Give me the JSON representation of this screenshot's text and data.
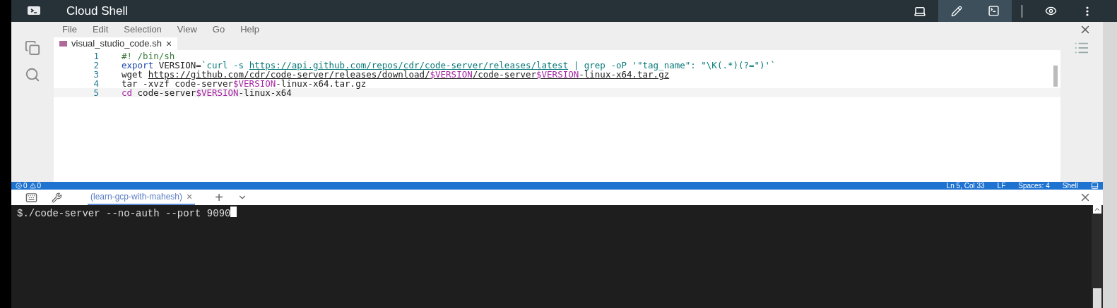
{
  "title_bar": {
    "title": "Cloud Shell",
    "tools": [
      {
        "kind": "laptop",
        "selected": false
      },
      {
        "kind": "pencil",
        "selected": true
      },
      {
        "kind": "terminal",
        "selected": true
      },
      {
        "kind": "preview",
        "selected": false
      },
      {
        "kind": "more",
        "selected": false
      }
    ]
  },
  "menu": [
    "File",
    "Edit",
    "Selection",
    "View",
    "Go",
    "Help"
  ],
  "editor_tab": {
    "label": "visual_studio_code.sh",
    "close": "×"
  },
  "code_lines": [
    {
      "number": "1",
      "tokens": [
        {
          "kind": "comment",
          "text": "#! /bin/sh"
        }
      ]
    },
    {
      "number": "2",
      "tokens": [
        {
          "kind": "keyword",
          "text": "export"
        },
        {
          "kind": "plain",
          "text": " VERSION="
        },
        {
          "kind": "string",
          "text": "`curl -s "
        },
        {
          "kind": "string-link",
          "text": "https://api.github.com/repos/cdr/code-server/releases/latest"
        },
        {
          "kind": "string",
          "text": " | grep -oP '\"tag_name\": \"\\K(.*)(?=\")'`"
        }
      ]
    },
    {
      "number": "3",
      "tokens": [
        {
          "kind": "plain",
          "text": "wget "
        },
        {
          "kind": "link",
          "text": "https://github.com/cdr/code-server/releases/download/"
        },
        {
          "kind": "var-link",
          "text": "$VERSION"
        },
        {
          "kind": "link",
          "text": "/code-server"
        },
        {
          "kind": "var-link",
          "text": "$VERSION"
        },
        {
          "kind": "link",
          "text": "-linux-x64.tar.gz"
        }
      ]
    },
    {
      "number": "4",
      "tokens": [
        {
          "kind": "plain",
          "text": "tar -xvzf code-server"
        },
        {
          "kind": "var",
          "text": "$VERSION"
        },
        {
          "kind": "plain",
          "text": "-linux-x64.tar.gz"
        }
      ]
    },
    {
      "number": "5",
      "tokens": [
        {
          "kind": "builtin",
          "text": "cd"
        },
        {
          "kind": "plain",
          "text": " code-server"
        },
        {
          "kind": "var",
          "text": "$VERSION"
        },
        {
          "kind": "plain",
          "text": "-linux-x64"
        }
      ]
    }
  ],
  "status_bar": {
    "errors": "0",
    "warnings": "0",
    "items": [
      "Ln 5, Col 33",
      "LF",
      "Spaces: 4",
      "Shell"
    ]
  },
  "terminal_tab": {
    "label": "(learn-gcp-with-mahesh)",
    "close": "×",
    "add": "+"
  },
  "terminal": {
    "prompt": "$",
    "command": "./code-server --no-auth --port 9090"
  }
}
